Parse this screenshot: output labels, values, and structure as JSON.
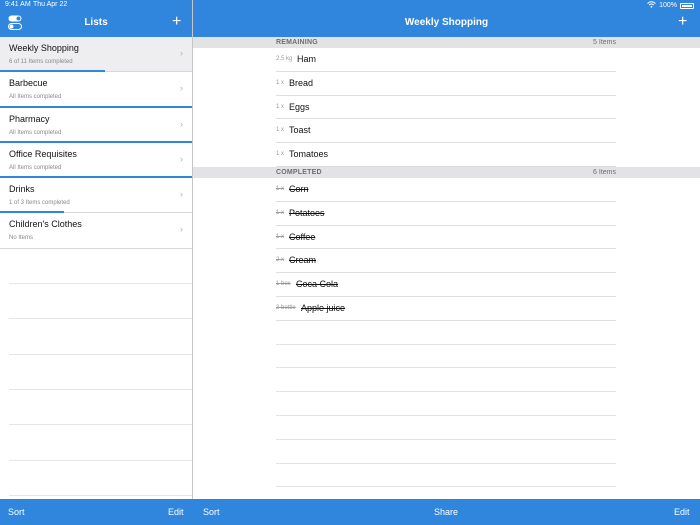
{
  "status": {
    "time": "9:41 AM",
    "date": "Thu Apr 22",
    "battery": "100%"
  },
  "sidebar": {
    "title": "Lists",
    "items": [
      {
        "title": "Weekly Shopping",
        "subtitle": "6 of 11 Items completed",
        "progress": 0.545,
        "selected": true
      },
      {
        "title": "Barbecue",
        "subtitle": "All Items completed",
        "progress": 1.0,
        "selected": false
      },
      {
        "title": "Pharmacy",
        "subtitle": "All Items completed",
        "progress": 1.0,
        "selected": false
      },
      {
        "title": "Office Requisites",
        "subtitle": "All Items completed",
        "progress": 1.0,
        "selected": false
      },
      {
        "title": "Drinks",
        "subtitle": "1 of 3 Items completed",
        "progress": 0.333,
        "selected": false
      },
      {
        "title": "Children's Clothes",
        "subtitle": "No Items",
        "progress": 0,
        "selected": false
      }
    ],
    "sort_label": "Sort",
    "edit_label": "Edit"
  },
  "main": {
    "title": "Weekly Shopping",
    "remaining": {
      "label": "REMAINING",
      "count": "5 Items",
      "items": [
        {
          "qty": "2.5 kg",
          "name": "Ham"
        },
        {
          "qty": "1 x",
          "name": "Bread"
        },
        {
          "qty": "1 x",
          "name": "Eggs"
        },
        {
          "qty": "1 x",
          "name": "Toast"
        },
        {
          "qty": "1 x",
          "name": "Tomatoes"
        }
      ]
    },
    "completed": {
      "label": "COMPLETED",
      "count": "6 Items",
      "items": [
        {
          "qty": "1 x",
          "name": "Corn"
        },
        {
          "qty": "1 x",
          "name": "Potatoes"
        },
        {
          "qty": "1 x",
          "name": "Coffee"
        },
        {
          "qty": "2 x",
          "name": "Cream"
        },
        {
          "qty": "1 box",
          "name": "Coca Cola"
        },
        {
          "qty": "3 bottle",
          "name": "Apple juice"
        }
      ]
    },
    "sort_label": "Sort",
    "share_label": "Share",
    "edit_label": "Edit"
  },
  "colors": {
    "accent": "#2f86dc",
    "section_bg": "#e3e3e5",
    "selected_bg": "#eeeef1"
  }
}
